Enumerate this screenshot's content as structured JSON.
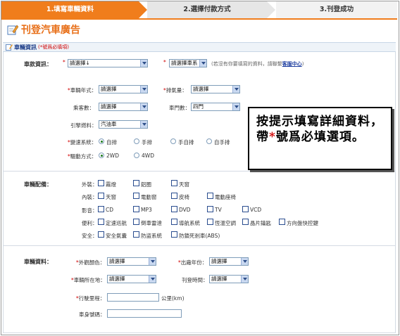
{
  "steps": [
    "1.填寫車輛資料",
    "2.選擇付款方式",
    "3.刊登成功"
  ],
  "page_title": "刊登汽車廣告",
  "section": {
    "title": "車輛資訊",
    "note": "(*號爲必填項)"
  },
  "car_model": {
    "label": "車款資訊：",
    "brand_select": "請選擇↓",
    "series_select": "請選擇車系",
    "note_text": "(若沒有你要填寫的資料，請聯繫",
    "note_link": "客服中心",
    "note_end": ")"
  },
  "fields": {
    "year_label": "車輛年式：",
    "year_value": "請選擇",
    "engine_label": "排氣量：",
    "engine_value": "請選擇",
    "seats_label": "乘客數：",
    "seats_value": "請選擇",
    "doors_label": "車門數：",
    "doors_value": "四門",
    "fuel_label": "引擎燃料：",
    "fuel_value": "汽油車",
    "trans_label": "變速系統：",
    "trans_options": [
      "自排",
      "手排",
      "手自排",
      "自手排"
    ],
    "drive_label": "驅動方式：",
    "drive_options": [
      "2WD",
      "4WD"
    ]
  },
  "equipment": {
    "label": "車輛配備：",
    "exterior": {
      "label": "外裝：",
      "items": [
        "霧燈",
        "鋁圈",
        "天窗"
      ]
    },
    "interior": {
      "label": "內裝：",
      "items": [
        "天窗",
        "電動窗",
        "皮椅",
        "電動座椅"
      ]
    },
    "audio": {
      "label": "影音：",
      "items": [
        "CD",
        "MP3",
        "DVD",
        "TV",
        "VCD"
      ]
    },
    "convenience": {
      "label": "便利：",
      "items": [
        "定速巡航",
        "倒車雷達",
        "導航系統",
        "恆溫空調",
        "晶片鑰匙",
        "方向盤快控鍵"
      ]
    },
    "safety": {
      "label": "安全：",
      "items": [
        "安全氣囊",
        "防盜系統",
        "防鎖死剎車(ABS)"
      ]
    }
  },
  "vehicle_info": {
    "label": "車輛資料：",
    "color_label": "外觀顏色：",
    "color_value": "請選擇",
    "made_label": "出廠年份：",
    "made_value": "請選擇",
    "location_label": "車輛所在地：",
    "location_value": "請選擇",
    "period_label": "刊登時間：",
    "period_value": "請選擇",
    "mileage_label": "行駛里程：",
    "mileage_unit": "公里(km)",
    "vin_label": "車身號碼："
  },
  "callout": {
    "part1": "按提示填寫詳細資料，帶",
    "star": "*",
    "part2": "號爲必填選項。"
  },
  "colors": {
    "accent": "#f07d1c",
    "title": "#e8701a",
    "link": "#1f3fa0",
    "required": "#d00000"
  }
}
